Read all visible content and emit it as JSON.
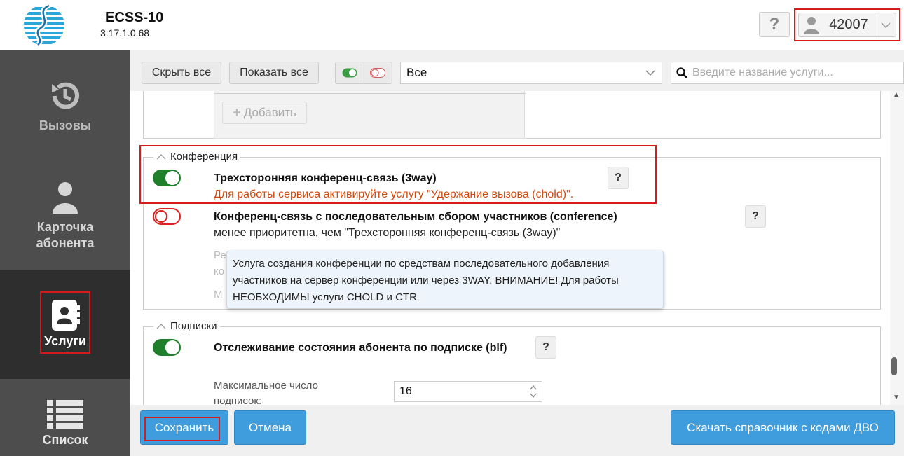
{
  "header": {
    "app_title": "ECSS-10",
    "app_version": "3.17.1.0.68",
    "help_label": "?",
    "user_number": "42007",
    "icons": {
      "logo": "ecss-logo",
      "user": "user-icon",
      "caret": "chevron-down-icon"
    }
  },
  "sidebar": {
    "items": [
      {
        "label": "Вызовы",
        "icon": "history-icon"
      },
      {
        "label": "Карточка абонента",
        "icon": "user-icon"
      },
      {
        "label": "Услуги",
        "icon": "address-book-icon",
        "active": true
      },
      {
        "label": "Список",
        "icon": "list-icon"
      }
    ]
  },
  "toolbar": {
    "hide_all": "Скрыть все",
    "show_all": "Показать все",
    "filter_value": "Все",
    "search_placeholder": "Введите название услуги..."
  },
  "content": {
    "add_button": "Добавить",
    "conference": {
      "legend": "Конференция",
      "service_3way": {
        "title": "Трехсторонняя конференц-связь (3way)",
        "note": "Для работы сервиса активируйте услугу \"Удержание вызова (chold)\".",
        "enabled": true
      },
      "service_conference": {
        "title": "Конференц-связь с последовательным сбором участников (conference)",
        "note": "менее приоритетна, чем \"Трехсторонняя конференц-связь (3way)\"",
        "enabled": false,
        "muted_1": "Ре",
        "muted_2": "ко",
        "muted_3": "М"
      },
      "tooltip": "Услуга создания конференции по средствам последовательного добавления участников на сервер конференции или через 3WAY. ВНИМАНИЕ! Для работы НЕОБХОДИМЫ услуги CHOLD и CTR"
    },
    "subscriptions": {
      "legend": "Подписки",
      "service_blf": {
        "title": "Отслеживание состояния абонента по подписке (blf)",
        "enabled": true
      },
      "max_subs_label": "Максимальное число подписок:",
      "max_subs_value": "16"
    },
    "help_label": "?"
  },
  "footer": {
    "save": "Сохранить",
    "cancel": "Отмена",
    "download": "Скачать справочник с кодами ДВО"
  },
  "colors": {
    "sidebar_bg": "#4d4d4d",
    "sidebar_active": "#2e2e2e",
    "highlight": "#d41c1c",
    "primary_button": "#3f9ddd",
    "toggle_on": "#1f7f2a",
    "toggle_off": "#e02020",
    "warning_text": "#d4480c"
  }
}
